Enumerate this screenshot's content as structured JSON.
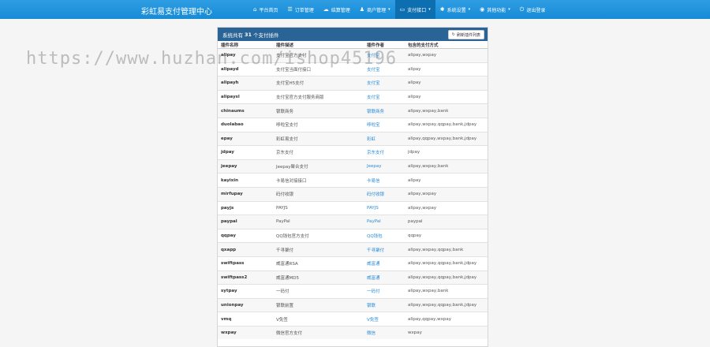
{
  "app": {
    "title": "彩虹易支付管理中心"
  },
  "nav": [
    {
      "icon": "⌂",
      "icon_name": "home-icon",
      "label": "平台首页",
      "caret": false,
      "active": false
    },
    {
      "icon": "☰",
      "icon_name": "list-icon",
      "label": "订单管理",
      "caret": false,
      "active": false
    },
    {
      "icon": "☁",
      "icon_name": "cloud-icon",
      "label": "结算管理",
      "caret": false,
      "active": false
    },
    {
      "icon": "♟",
      "icon_name": "user-icon",
      "label": "商户管理",
      "caret": true,
      "active": false
    },
    {
      "icon": "▭",
      "icon_name": "card-icon",
      "label": "支付接口",
      "caret": true,
      "active": true
    },
    {
      "icon": "✱",
      "icon_name": "gear-icon",
      "label": "系统设置",
      "caret": true,
      "active": false
    },
    {
      "icon": "◉",
      "icon_name": "globe-icon",
      "label": "其他功能",
      "caret": true,
      "active": false
    },
    {
      "icon": "⏻",
      "icon_name": "power-icon",
      "label": "退出登录",
      "caret": false,
      "active": false
    }
  ],
  "panel": {
    "title_prefix": "系统共有",
    "count": "31",
    "title_suffix": "个支付插件",
    "refresh_label": "刷新插件列表",
    "refresh_icon": "refresh-icon"
  },
  "table": {
    "headers": [
      "插件名称",
      "插件描述",
      "插件作者",
      "包含的支付方式"
    ],
    "rows": [
      [
        "alipay",
        "支付宝官方支付",
        "支付宝",
        "alipay,wxpay"
      ],
      [
        "alipayd",
        "支付宝当面付接口",
        "支付宝",
        "alipay"
      ],
      [
        "alipayh",
        "支付宝H5支付",
        "支付宝",
        "alipay"
      ],
      [
        "alipaysl",
        "支付宝官方支付服务商版",
        "支付宝",
        "alipay"
      ],
      [
        "chinaums",
        "银联商务",
        "银联商务",
        "alipay,wxpay,bank"
      ],
      [
        "duolabao",
        "哆啦宝支付",
        "哆啦宝",
        "alipay,wxpay,qqpay,bank,jdpay"
      ],
      [
        "epay",
        "彩虹易支付",
        "彩虹",
        "alipay,qqpay,wxpay,bank,jdpay"
      ],
      [
        "jdpay",
        "京东支付",
        "京东支付",
        "jdpay"
      ],
      [
        "jeepay",
        "Jeepay聚合支付",
        "Jeepay",
        "alipay,wxpay,bank"
      ],
      [
        "kayixin",
        "卡易信对接接口",
        "卡易信",
        "alipay"
      ],
      [
        "mirfupay",
        "码付收银",
        "码付收银",
        "alipay,wxpay"
      ],
      [
        "payjs",
        "PAYJS",
        "PAYJS",
        "alipay,wxpay"
      ],
      [
        "paypal",
        "PayPal",
        "PayPal",
        "paypal"
      ],
      [
        "qqpay",
        "QQ钱包官方支付",
        "QQ钱包",
        "qqpay"
      ],
      [
        "qxapp",
        "千寻聚付",
        "千寻聚付",
        "alipay,wxpay,qqpay,bank"
      ],
      [
        "swiftpass",
        "威富通RSA",
        "威富通",
        "alipay,wxpay,qqpay,bank,jdpay"
      ],
      [
        "swiftpass2",
        "威富通MD5",
        "威富通",
        "alipay,wxpay,qqpay,bank,jdpay"
      ],
      [
        "sytpay",
        "一码付",
        "一码付",
        "alipay,wxpay,bank"
      ],
      [
        "unionpay",
        "银联前置",
        "银联",
        "alipay,wxpay,qqpay,bank,jdpay"
      ],
      [
        "vmq",
        "V免签",
        "V免签",
        "alipay,qqpay,wxpay"
      ],
      [
        "wxpay",
        "微信官方支付",
        "微信",
        "wxpay"
      ]
    ]
  },
  "watermark": "https://www.huzhan.com/ishop45196"
}
